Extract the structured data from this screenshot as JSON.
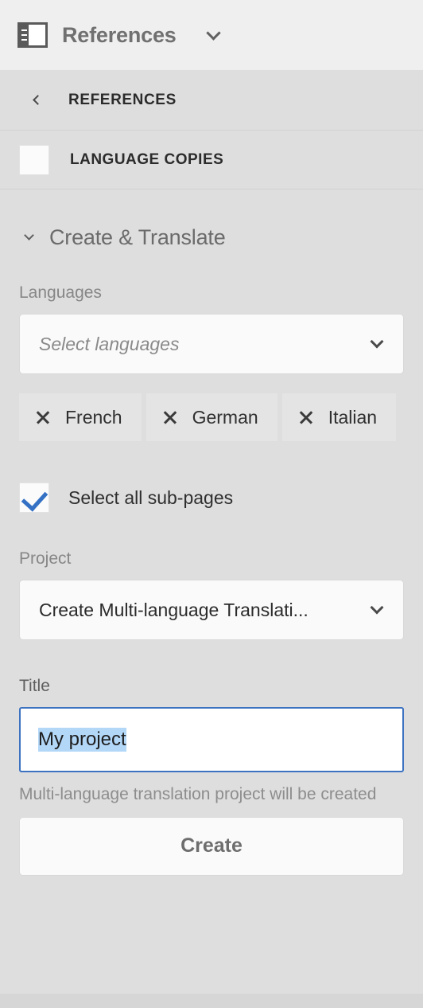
{
  "rail": {
    "icon": "panel-rail-icon",
    "title": "References",
    "caret": "chevron-down-icon"
  },
  "panel_bar": {
    "back_icon": "chevron-left-icon",
    "title": "REFERENCES"
  },
  "language_copies": {
    "checkbox_checked": false,
    "title": "LANGUAGE COPIES"
  },
  "accordion": {
    "caret": "chevron-down-icon",
    "title": "Create & Translate",
    "expanded": true
  },
  "languages": {
    "label": "Languages",
    "placeholder": "Select languages",
    "caret": "chevron-down-icon",
    "tags": [
      {
        "label": "French",
        "remove_icon": "close-icon"
      },
      {
        "label": "German",
        "remove_icon": "close-icon"
      },
      {
        "label": "Italian",
        "remove_icon": "close-icon"
      }
    ]
  },
  "sub_pages": {
    "label": "Select all sub-pages",
    "checked": true
  },
  "project": {
    "label": "Project",
    "value": "Create Multi-language Translati...",
    "caret": "chevron-down-icon"
  },
  "title_field": {
    "label": "Title",
    "value": "My project",
    "selected": true,
    "helper": "Multi-language translation project will be created"
  },
  "create_button": {
    "label": "Create"
  },
  "colors": {
    "rail_bg": "#efefef",
    "panel_bg": "#dedede",
    "tag_bg": "#e4e4e4",
    "field_bg": "#fafafa",
    "accent_blue": "#3471c4",
    "focus_border": "#3c72c0",
    "selection_blue": "#b3d7f7",
    "title_text": "#2b2b2b",
    "muted_text": "#8a8a8a"
  }
}
